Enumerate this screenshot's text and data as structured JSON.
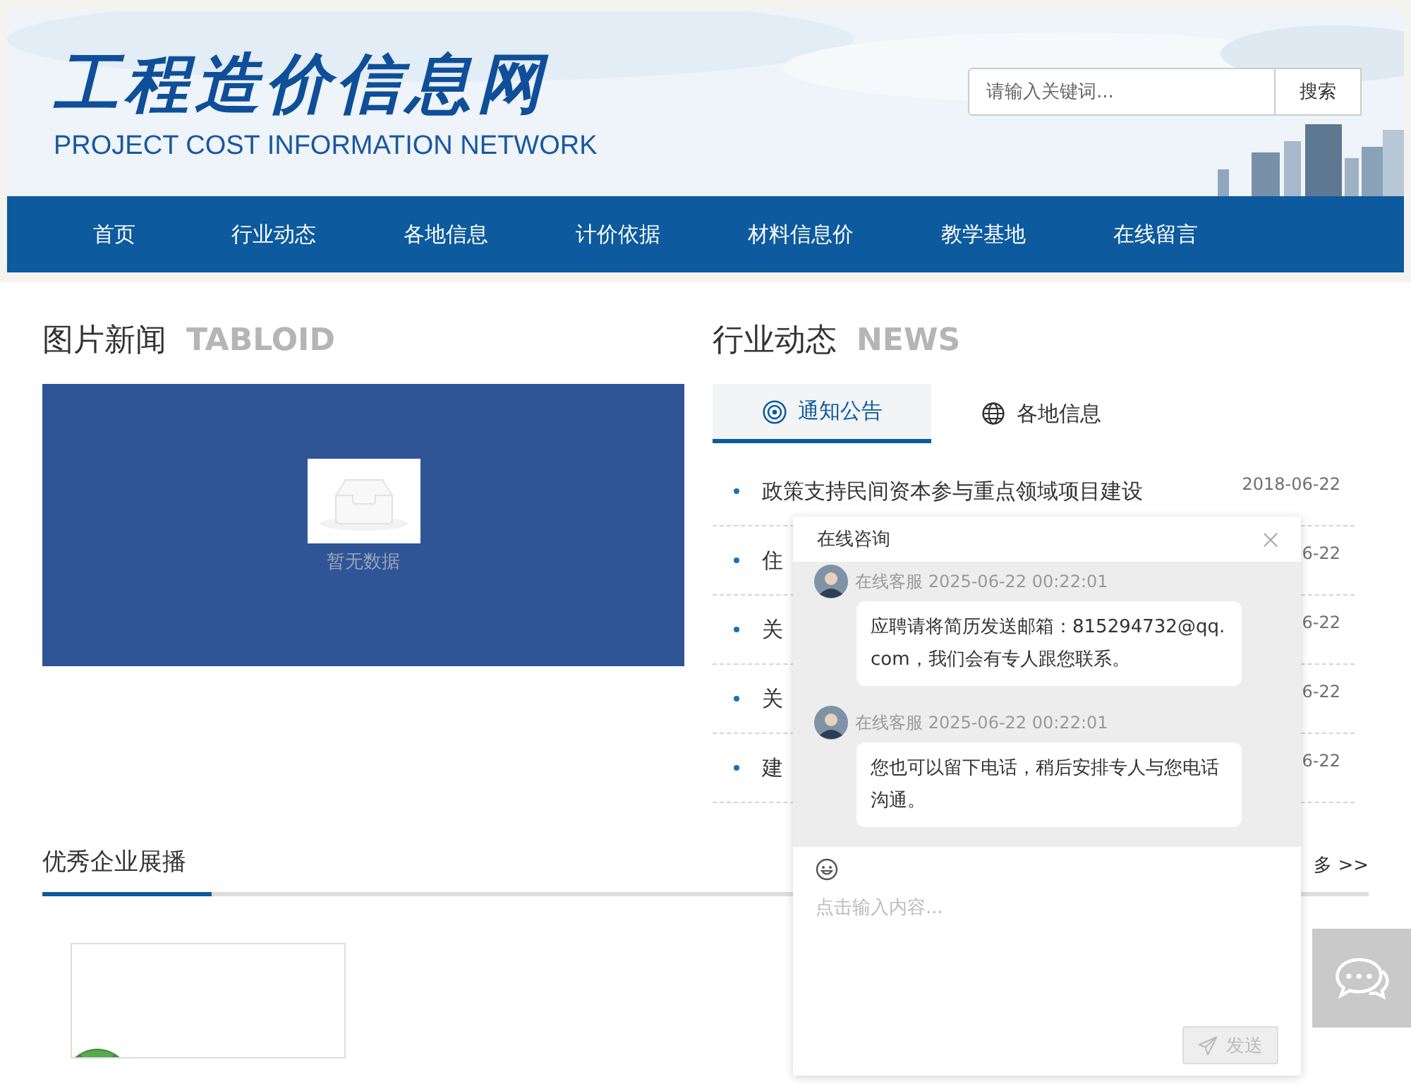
{
  "header": {
    "logo_title": "工程造价信息网",
    "logo_subtitle": "PROJECT COST INFORMATION NETWORK",
    "search": {
      "placeholder": "请输入关键词...",
      "button": "搜索"
    }
  },
  "nav": [
    "首页",
    "行业动态",
    "各地信息",
    "计价依据",
    "材料信息价",
    "教学基地",
    "在线留言"
  ],
  "picture_news": {
    "title": "图片新闻",
    "subtitle": "TABLOID",
    "empty_text": "暂无数据"
  },
  "industry_news": {
    "title": "行业动态",
    "subtitle": "NEWS",
    "tabs": [
      {
        "label": "通知公告",
        "selected": true
      },
      {
        "label": "各地信息",
        "selected": false
      }
    ],
    "items": [
      {
        "title": "政策支持民间资本参与重点领域项目建设",
        "date": "2018-06-22"
      },
      {
        "title": "住",
        "date": "6-22"
      },
      {
        "title": "关",
        "date": "6-22"
      },
      {
        "title": "关",
        "date": "6-22"
      },
      {
        "title": "建",
        "date": "6-22"
      }
    ]
  },
  "companies": {
    "title": "优秀企业展播",
    "more": "多 >>"
  },
  "chat": {
    "title": "在线咨询",
    "messages": [
      {
        "sender": "在线客服",
        "time": "2025-06-22 00:22:01",
        "text": "应聘请将简历发送邮箱：815294732@qq.com，我们会有专人跟您联系。"
      },
      {
        "sender": "在线客服",
        "time": "2025-06-22 00:22:01",
        "text": "您也可以留下电话，稍后安排专人与您电话沟通。"
      }
    ],
    "placeholder": "点击输入内容...",
    "send_button": {
      "label": "发送",
      "disabled": true
    }
  }
}
